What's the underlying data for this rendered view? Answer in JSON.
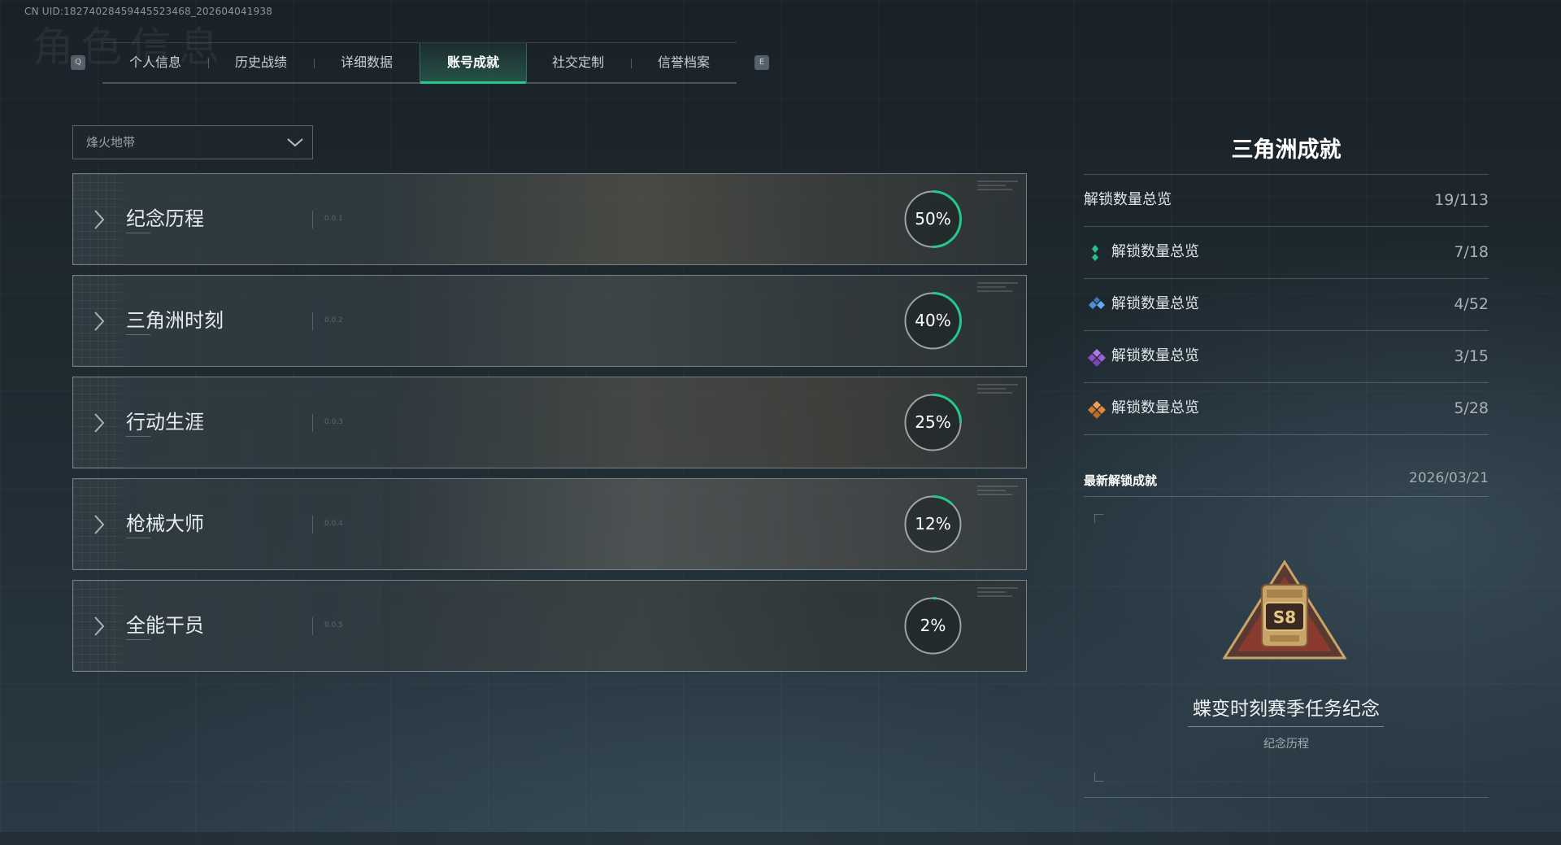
{
  "uid": "CN UID:18274028459445523468_202604041938",
  "bg_title": "角色信息",
  "tabs": {
    "key_left": "Q",
    "key_right": "E",
    "items": [
      {
        "label": "个人信息"
      },
      {
        "label": "历史战绩"
      },
      {
        "label": "详细数据"
      },
      {
        "label": "账号成就",
        "active": true
      },
      {
        "label": "社交定制"
      },
      {
        "label": "信誉档案"
      }
    ]
  },
  "mode_select": {
    "value": "烽火地带"
  },
  "categories": [
    {
      "name": "纪念历程",
      "code": "0.0.1",
      "progress_pct": 50,
      "progress_label": "50%"
    },
    {
      "name": "三角洲时刻",
      "code": "0.0.2",
      "progress_pct": 40,
      "progress_label": "40%"
    },
    {
      "name": "行动生涯",
      "code": "0.0.3",
      "progress_pct": 25,
      "progress_label": "25%"
    },
    {
      "name": "枪械大师",
      "code": "0.0.4",
      "progress_pct": 12,
      "progress_label": "12%"
    },
    {
      "name": "全能干员",
      "code": "0.0.5",
      "progress_pct": 2,
      "progress_label": "2%"
    }
  ],
  "colors": {
    "accent": "#25c88a",
    "gem_green": "#27c08a",
    "gem_blue": "#4a8fd8",
    "gem_purple": "#9a62d8",
    "gem_orange": "#e08a3a"
  },
  "panel": {
    "title": "三角洲成就",
    "total": {
      "label": "解锁数量总览",
      "value": "19/113"
    },
    "tiers": [
      {
        "icon": "green-gem-icon",
        "label": "解锁数量总览",
        "value": "7/18"
      },
      {
        "icon": "blue-gem-icon",
        "label": "解锁数量总览",
        "value": "4/52"
      },
      {
        "icon": "purple-gem-icon",
        "label": "解锁数量总览",
        "value": "3/15"
      },
      {
        "icon": "orange-gem-icon",
        "label": "解锁数量总览",
        "value": "5/28"
      }
    ],
    "latest": {
      "heading": "最新解锁成就",
      "date": "2026/03/21",
      "badge_text": "S8",
      "name": "蝶变时刻赛季任务纪念",
      "category": "纪念历程"
    }
  }
}
